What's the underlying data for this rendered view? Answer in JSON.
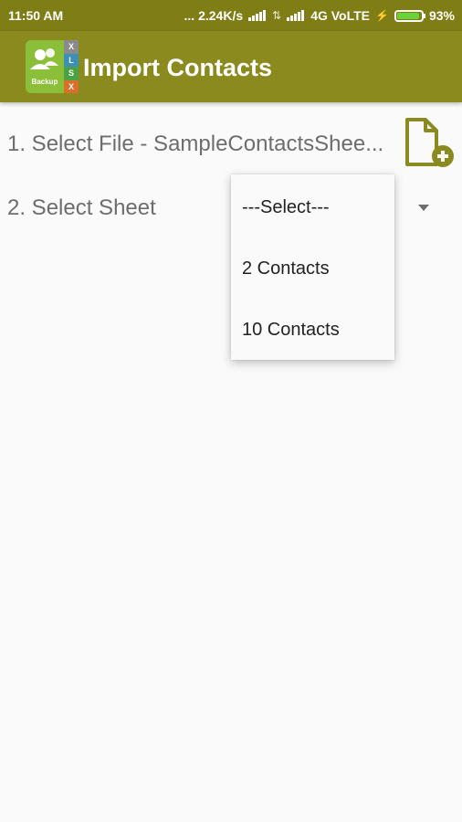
{
  "status": {
    "time": "11:50 AM",
    "network_speed": "... 2.24K/s",
    "network_type": "4G VoLTE",
    "battery": "93%",
    "battery_level": 0.93,
    "battery_color": "#6ad33a"
  },
  "appbar": {
    "title": "Import Contacts",
    "logo_letters": [
      "X",
      "L",
      "S",
      "X"
    ],
    "logo_text": "Backup"
  },
  "form": {
    "select_file_label": "1. Select File  -  SampleContactsShee...",
    "select_sheet_label": "2. Select Sheet"
  },
  "dropdown": {
    "options": [
      "---Select---",
      "2 Contacts",
      "10 Contacts"
    ]
  },
  "colors": {
    "statusbar": "#7f7d16",
    "appbar": "#8b8a1e",
    "accent": "#8b8a1e"
  },
  "icons": [
    "file-add-icon",
    "dropdown-arrow-icon",
    "signal-icon",
    "battery-icon",
    "charging-icon"
  ]
}
